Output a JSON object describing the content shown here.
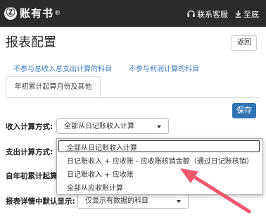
{
  "header": {
    "logo_glyph": "Ⓩ",
    "logo_text": "账有书",
    "logo_mark": "®",
    "contact_label": "联系客服",
    "bottom_label": "至底"
  },
  "page": {
    "title": "报表配置",
    "back_label": "返回"
  },
  "links": {
    "exclude_total": "不参与总收入总支出计算的科目",
    "exclude_profit": "不参与利润计算的科目"
  },
  "tabs": [
    {
      "label": "年初累计起算月份及其他"
    }
  ],
  "save_label": "保存",
  "form": {
    "income_label": "收入计算方式:",
    "income_value": "全部从日记账收入计算",
    "expense_label": "支出计算方式:",
    "ytd_label": "自年初累计起算月",
    "detail_label": "报表详情中默认显示:",
    "detail_value": "仅显示有数据的科目"
  },
  "dropdown": {
    "options": [
      "全部从日记账收入计算",
      "日记账收入 + 应收账 - 应收账核销金额（通过日记账核销）",
      "日记账收入 + 应收账",
      "全部从应收账计算"
    ],
    "selected_index": 0
  },
  "colors": {
    "topbar": "#2b2b2b",
    "link": "#3a7ab7",
    "primary": "#2f74b5",
    "arrow": "#f0566e"
  },
  "icons": {
    "contact": "headset-icon",
    "bottom": "arrow-to-bottom-icon",
    "select_caret": "caret-down-icon"
  }
}
